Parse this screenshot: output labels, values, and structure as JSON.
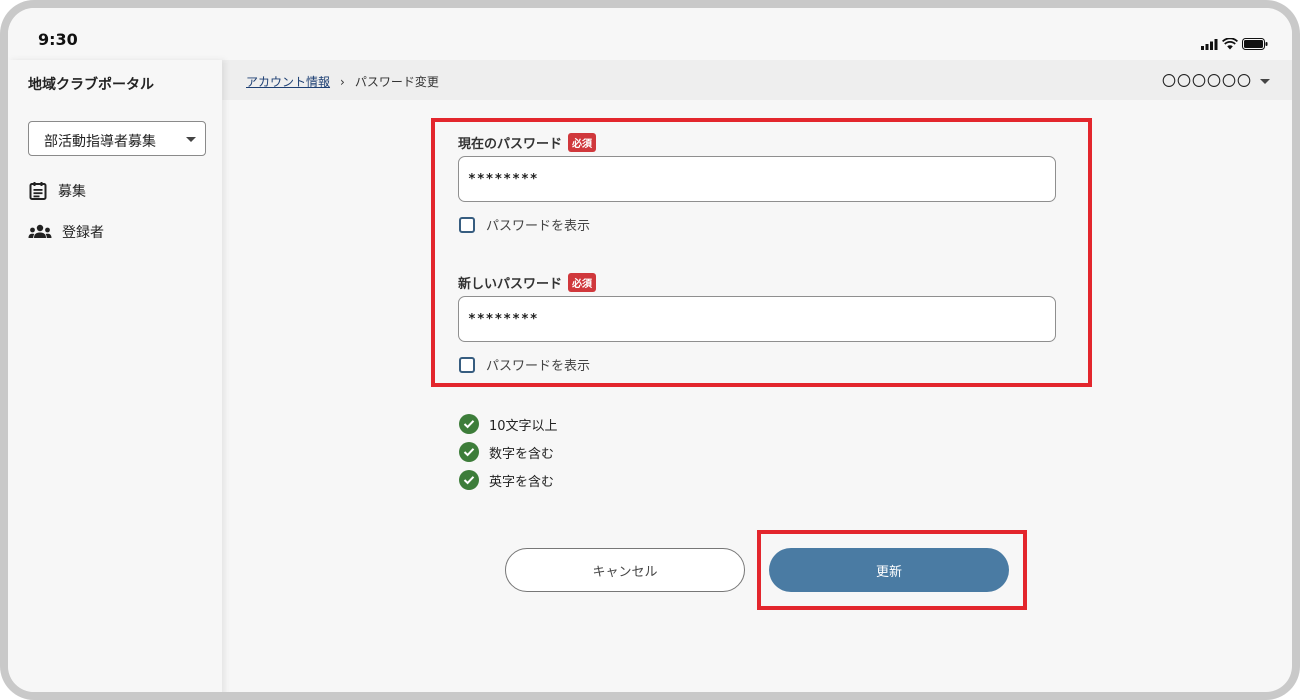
{
  "status_bar": {
    "time": "9:30"
  },
  "sidebar": {
    "app_title": "地域クラブポータル",
    "selector": {
      "value": "部活動指導者募集"
    },
    "items": [
      {
        "label": "募集",
        "icon": "clipboard-list-icon"
      },
      {
        "label": "登録者",
        "icon": "group-icon"
      }
    ]
  },
  "header": {
    "breadcrumb": {
      "parent": "アカウント情報",
      "current": "パスワード変更"
    },
    "user_menu": "〇〇〇〇〇〇"
  },
  "form": {
    "current_password": {
      "label": "現在のパスワード",
      "required_badge": "必須",
      "value": "********",
      "show_label": "パスワードを表示"
    },
    "new_password": {
      "label": "新しいパスワード",
      "required_badge": "必須",
      "value": "********",
      "show_label": "パスワードを表示"
    },
    "rules": [
      {
        "text": "10文字以上",
        "satisfied": true
      },
      {
        "text": "数字を含む",
        "satisfied": true
      },
      {
        "text": "英字を含む",
        "satisfied": true
      }
    ]
  },
  "actions": {
    "cancel_label": "キャンセル",
    "update_label": "更新"
  },
  "colors": {
    "highlight": "#e3262d",
    "primary_button": "#4a7ba3",
    "required_badge": "#d0383c",
    "check_ok": "#3d7d3a"
  }
}
